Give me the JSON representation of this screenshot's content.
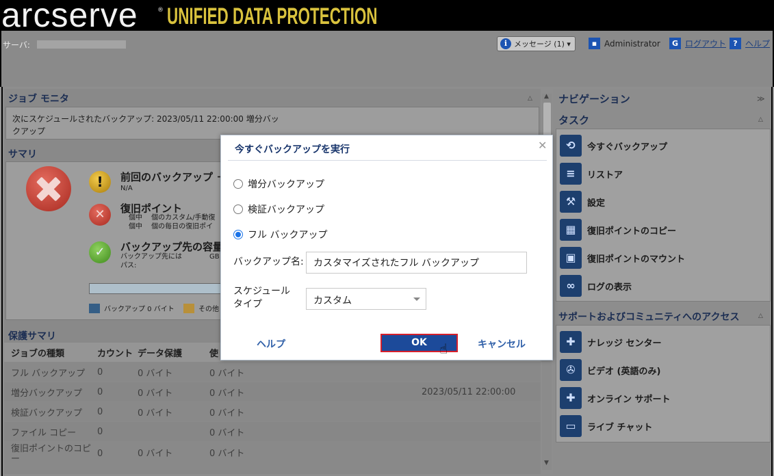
{
  "header": {
    "brand": "arcserve",
    "reg": "®",
    "product": "UNIFIED DATA PROTECTION",
    "server_label": "サーバ:",
    "messages_label": "メッセージ (1) ▾",
    "user": "Administrator",
    "logout": "ログアウト",
    "help": "ヘルプ"
  },
  "job_monitor": {
    "title": "ジョブ モニタ",
    "schedule_text": "次にスケジュールされたバックアップ: 2023/05/11 22:00:00 増分バックアップ"
  },
  "summary": {
    "title": "サマリ",
    "last_backup_title": "前回のバックアップ －",
    "last_backup_value": "N/A",
    "recovery_points_title": "復旧ポイント",
    "recovery_points_sub1": "個中　 個のカスタム/手動復",
    "recovery_points_sub2": "個中　 個の毎日の復旧ポイ",
    "dest_capacity_title": "バックアップ先の容量",
    "dest_capacity_sub1": "バックアップ先には　　　　GB の",
    "dest_capacity_sub2": "パス:",
    "legend_backup": "バックアップ 0 バイト",
    "legend_other": "その他"
  },
  "protection_summary": {
    "title": "保護サマリ",
    "columns": [
      "ジョブの種類",
      "カウント",
      "データ保護",
      "使"
    ],
    "rows": [
      {
        "type": "フル バックアップ",
        "count": "0",
        "data": "0 バイト",
        "used": "0 バイト",
        "next": ""
      },
      {
        "type": "増分バックアップ",
        "count": "0",
        "data": "0 バイト",
        "used": "0 バイト",
        "next": "2023/05/11 22:00:00"
      },
      {
        "type": "検証バックアップ",
        "count": "0",
        "data": "0 バイト",
        "used": "0 バイト",
        "next": ""
      },
      {
        "type": "ファイル コピー",
        "count": "0",
        "data": "",
        "used": "0 バイト",
        "next": ""
      },
      {
        "type": "復旧ポイントのコピー",
        "count": "0",
        "data": "0 バイト",
        "used": "0 バイト",
        "next": ""
      }
    ]
  },
  "navigation": {
    "title": "ナビゲーション",
    "tasks_title": "タスク",
    "tasks": [
      "今すぐバックアップ",
      "リストア",
      "設定",
      "復旧ポイントのコピー",
      "復旧ポイントのマウント",
      "ログの表示"
    ],
    "support_title": "サポートおよびコミュニティへのアクセス",
    "support": [
      "ナレッジ センター",
      "ビデオ (英語のみ)",
      "オンライン サポート",
      "ライブ チャット"
    ]
  },
  "dialog": {
    "title": "今すぐバックアップを実行",
    "options": [
      "増分バックアップ",
      "検証バックアップ",
      "フル バックアップ"
    ],
    "selected_option": "フル バックアップ",
    "name_label": "バックアップ名:",
    "name_value": "カスタマイズされたフル バックアップ",
    "schedule_label": "スケジュール タイプ",
    "schedule_value": "カスタム",
    "help": "ヘルプ",
    "ok": "OK",
    "cancel": "キャンセル"
  }
}
